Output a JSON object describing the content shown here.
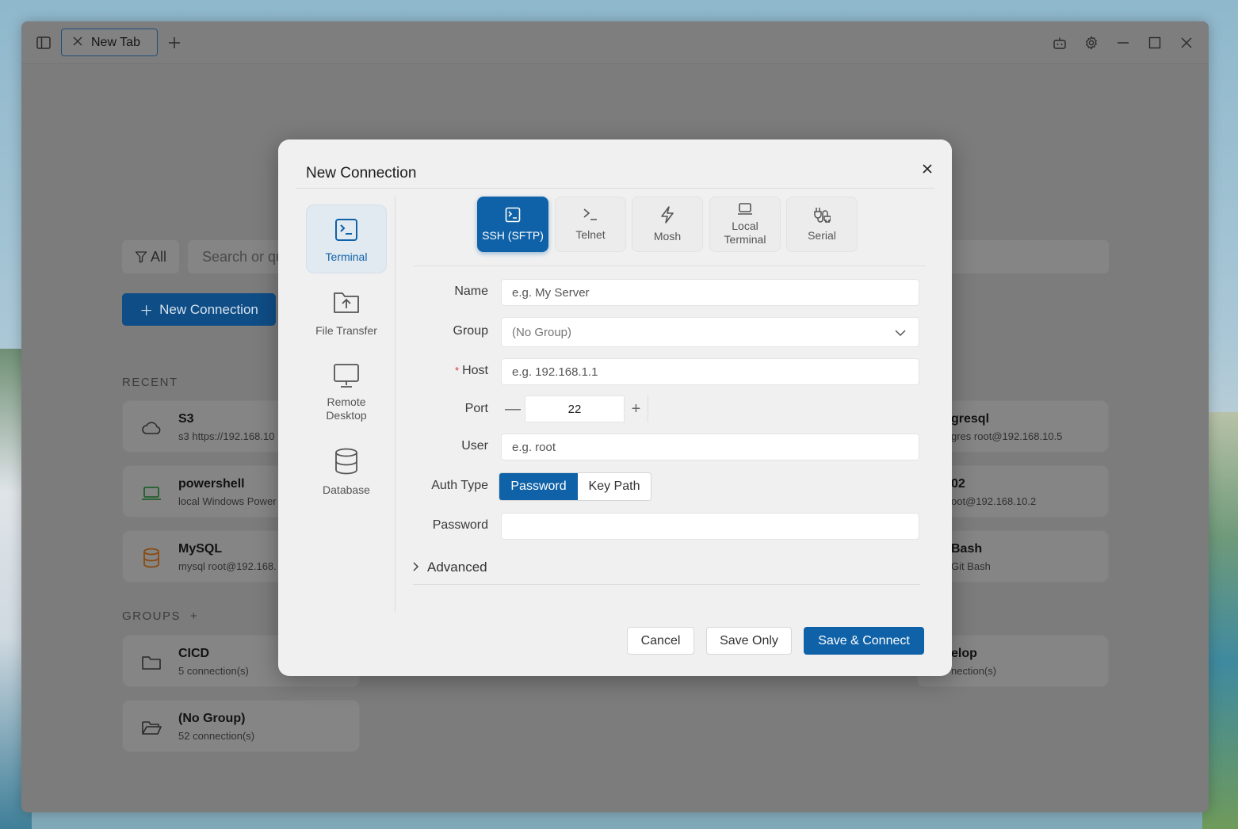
{
  "window": {
    "tab_label": "New Tab",
    "icons": [
      "sidebar-toggle-icon",
      "close-tab-icon",
      "plus-icon",
      "bot-icon",
      "gear-icon",
      "minimize-icon",
      "maximize-icon",
      "close-icon"
    ]
  },
  "background": {
    "filter_label": "All",
    "search_placeholder": "Search or qu",
    "new_connection_label": "New Connection",
    "recent_label": "RECENT",
    "groups_label": "GROUPS",
    "groups_add": "+",
    "recent": [
      {
        "title": "S3",
        "sub": "s3 https://192.168.10"
      },
      {
        "title": "powershell",
        "sub": "local Windows Power"
      },
      {
        "title": "MySQL",
        "sub": "mysql root@192.168."
      }
    ],
    "recent_right": [
      {
        "title": "gresql",
        "sub": "gres root@192.168.10.5"
      },
      {
        "title": "02",
        "sub": "oot@192.168.10.2"
      },
      {
        "title": "Bash",
        "sub": "Git Bash"
      }
    ],
    "groups": [
      {
        "title": "CICD",
        "sub": "5 connection(s)"
      },
      {
        "title": "(No Group)",
        "sub": "52 connection(s)"
      }
    ],
    "groups_right": [
      {
        "title": "elop",
        "sub": "nection(s)"
      }
    ]
  },
  "dialog": {
    "title": "New Connection",
    "categories": [
      {
        "label": "Terminal",
        "active": true
      },
      {
        "label": "File Transfer"
      },
      {
        "label": "Remote Desktop"
      },
      {
        "label": "Database"
      }
    ],
    "protocols": [
      {
        "label": "SSH (SFTP)",
        "active": true
      },
      {
        "label": "Telnet"
      },
      {
        "label": "Mosh"
      },
      {
        "label": "Local Terminal"
      },
      {
        "label": "Serial"
      }
    ],
    "form": {
      "name_label": "Name",
      "name_placeholder": "e.g. My Server",
      "group_label": "Group",
      "group_value": "(No Group)",
      "host_required": "*",
      "host_label": "Host",
      "host_placeholder": "e.g. 192.168.1.1",
      "port_label": "Port",
      "port_value": "22",
      "port_minus": "—",
      "port_plus": "+",
      "user_label": "User",
      "user_placeholder": "e.g. root",
      "auth_label": "Auth Type",
      "auth_options": [
        "Password",
        "Key Path"
      ],
      "auth_selected": "Password",
      "password_label": "Password",
      "password_value": "",
      "advanced_label": "Advanced"
    },
    "buttons": {
      "cancel": "Cancel",
      "save_only": "Save Only",
      "save_connect": "Save & Connect"
    }
  },
  "colors": {
    "accent": "#0f62a8",
    "overlay": "#7c7c7c",
    "dialog_bg": "#f0f0f0"
  }
}
